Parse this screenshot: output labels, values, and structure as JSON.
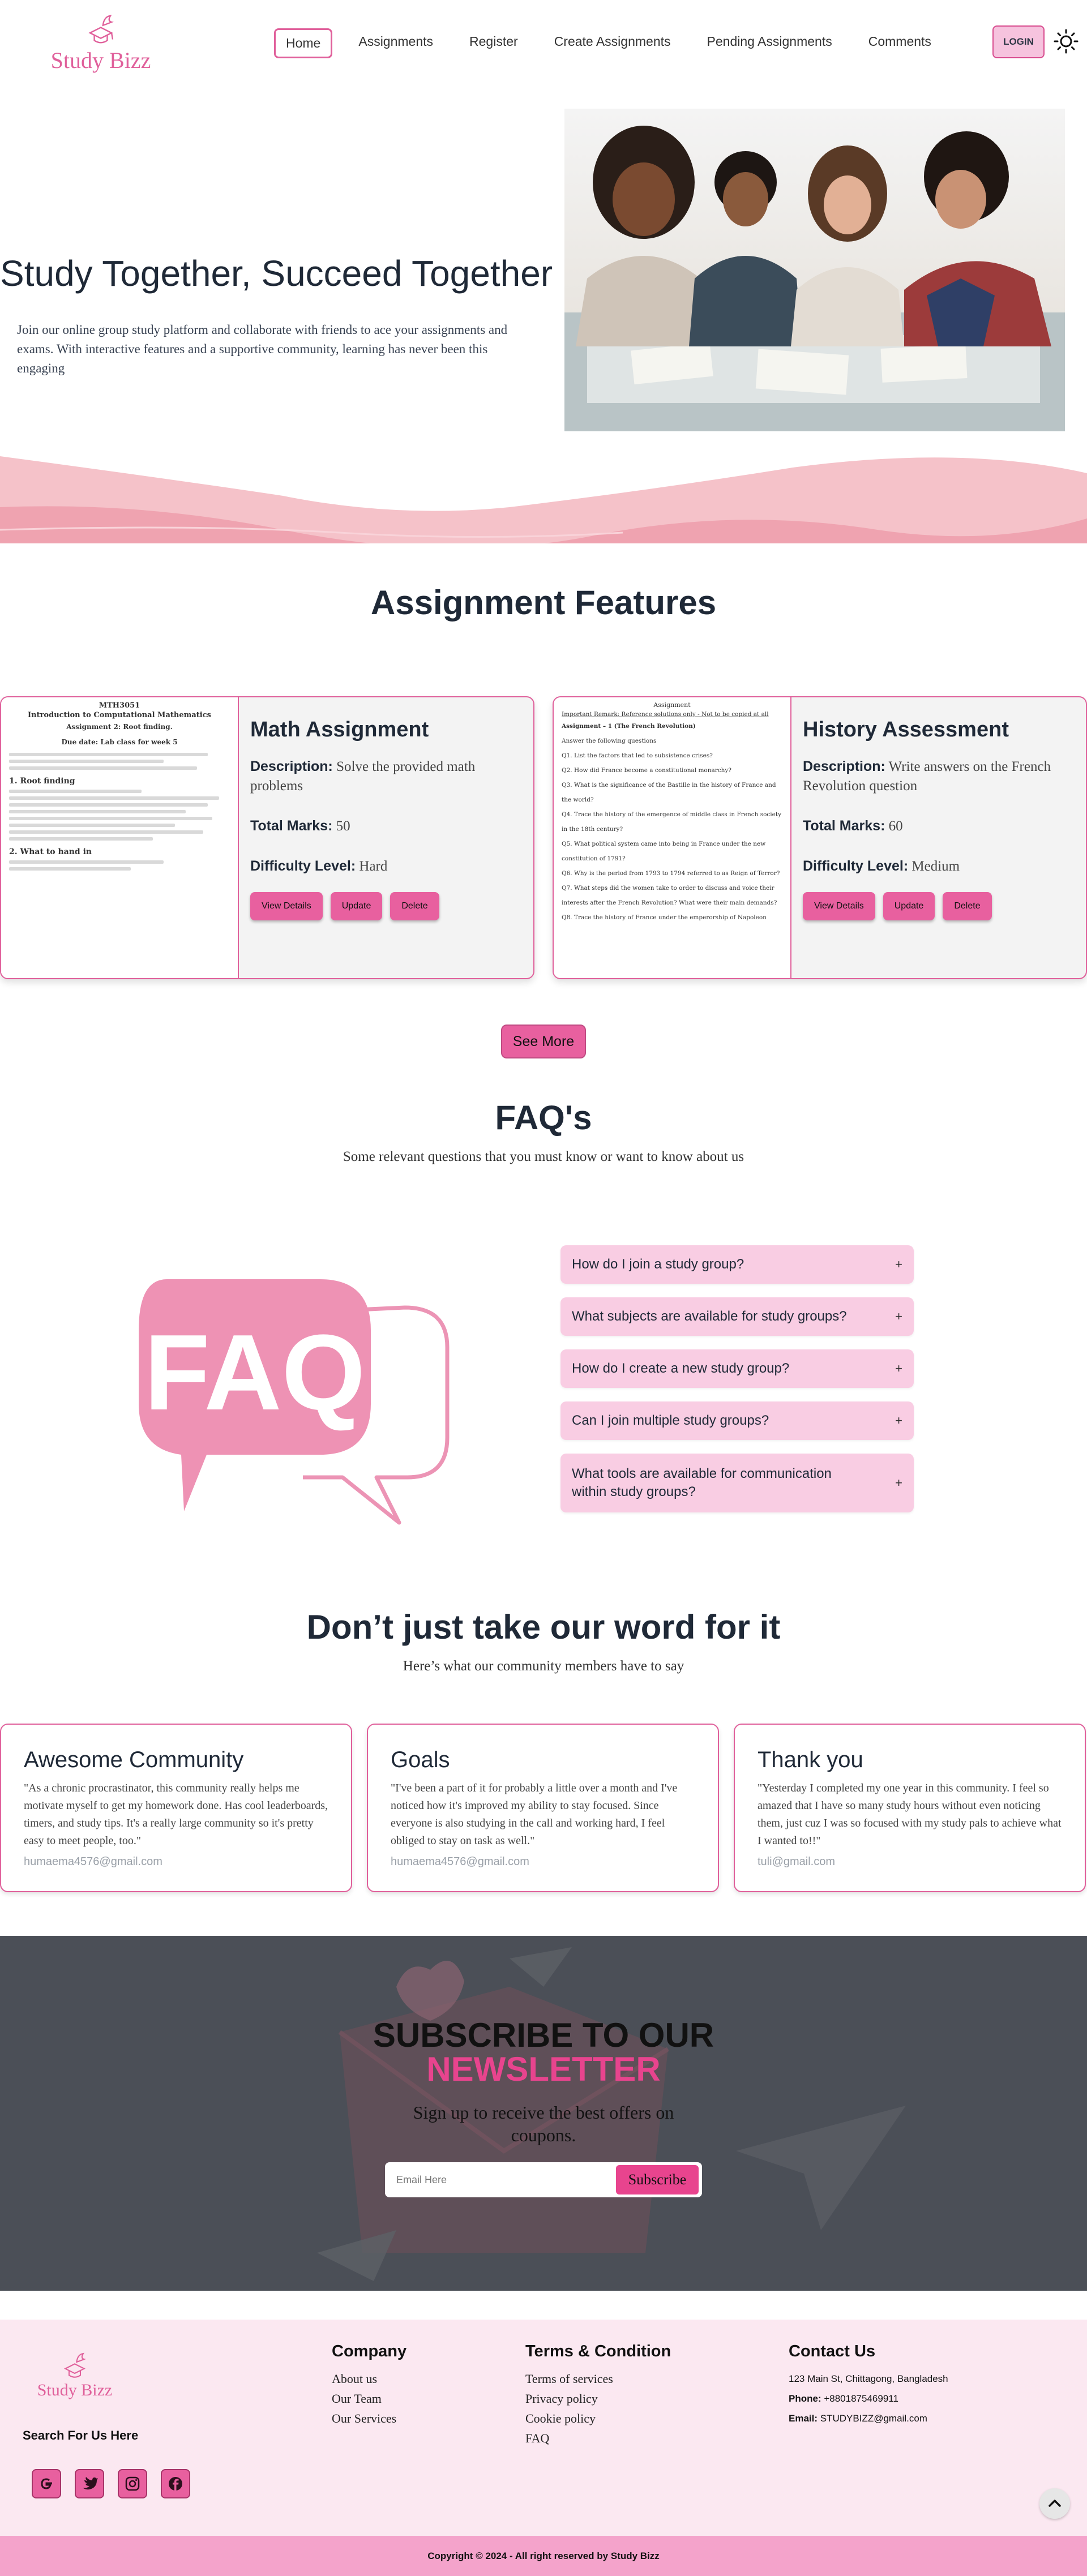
{
  "brand": {
    "name": "Study Bizz"
  },
  "nav": {
    "links": [
      "Home",
      "Assignments",
      "Register",
      "Create Assignments",
      "Pending Assignments",
      "Comments"
    ],
    "login": "LOGIN"
  },
  "hero": {
    "title": "Study Together, Succeed Together",
    "text": "Join our online group study platform and collaborate with friends to ace your assignments and exams. With interactive features and a supportive community, learning has never been this engaging"
  },
  "features": {
    "title": "Assignment Features",
    "cards": [
      {
        "title": "Math Assignment",
        "description_label": "Description:",
        "description": "Solve the provided math problems",
        "marks_label": "Total Marks:",
        "marks": "50",
        "difficulty_label": "Difficulty Level:",
        "difficulty": "Hard",
        "doc": {
          "code": "MTH3051",
          "title": "Introduction to Computational Mathematics",
          "subtitle": "Assignment 2: Root finding.",
          "due": "Due date: Lab class for week 5",
          "section1": "1. Root finding",
          "section2": "2. What to hand in"
        }
      },
      {
        "title": "History Assessment",
        "description_label": "Description:",
        "description": "Write answers on the French Revolution question",
        "marks_label": "Total Marks:",
        "marks": "60",
        "difficulty_label": "Difficulty Level:",
        "difficulty": "Medium",
        "doc": {
          "code": "Assignment",
          "title": "Important Remark: Reference solutions only - Not to be copied at all",
          "subtitle": "Assignment – 1 (The French Revolution)",
          "due": "Answer the following questions",
          "q1": "Q1. List the factors that led to subsistence crises?",
          "q2": "Q2. How did France become a constitutional monarchy?",
          "q3": "Q3. What is the significance of the Bastille in the history of France and the world?",
          "q4": "Q4. Trace the history of the emergence of middle class in French society in the 18th century?",
          "q5": "Q5. What political system came into being in France under the new constitution of 1791?",
          "q6": "Q6. Why is the period from 1793 to 1794 referred to as Reign of Terror?",
          "q7": "Q7. What steps did the women take to order to discuss and voice their interests after the French Revolution? What were their main demands?",
          "q8": "Q8. Trace the history of France under the emperorship of Napoleon"
        }
      }
    ],
    "buttons": {
      "details": "View Details",
      "update": "Update",
      "delete": "Delete"
    },
    "see_more": "See More"
  },
  "faq": {
    "title": "FAQ's",
    "subtitle": "Some relevant questions that you must know or want to know about us",
    "art_text": "FAQ",
    "items": [
      "How do I join a study group?",
      "What subjects are available for study groups?",
      "How do I create a new study group?",
      "Can I join multiple study groups?",
      "What tools are available for communication within study groups?"
    ]
  },
  "testimonials": {
    "title": "Don’t just take our word for it",
    "subtitle": "Here’s what our community members have to say",
    "items": [
      {
        "title": "Awesome Community",
        "text": "\"As a chronic procrastinator, this community really helps me motivate myself to get my homework done. Has cool leaderboards, timers, and study tips. It's a really large community so it's pretty easy to meet people, too.\"",
        "email": "humaema4576@gmail.com"
      },
      {
        "title": "Goals",
        "text": "\"I've been a part of it for probably a little over a month and I've noticed how it's improved my ability to stay focused. Since everyone is also studying in the call and working hard, I feel obliged to stay on task as well.\"",
        "email": "humaema4576@gmail.com"
      },
      {
        "title": "Thank you",
        "text": "\"Yesterday I completed my one year in this community. I feel so amazed that I have so many study hours without even noticing them, just cuz I was so focused with my study pals to achieve what I wanted to!!\"",
        "email": "tuli@gmail.com"
      }
    ]
  },
  "newsletter": {
    "line1": "SUBSCRIBE TO OUR",
    "line2": "NEWSLETTER",
    "text": "Sign up to receive the best offers on coupons.",
    "placeholder": "Email Here",
    "button": "Subscribe"
  },
  "footer": {
    "search_us": "Search For Us Here",
    "company": {
      "title": "Company",
      "links": [
        "About us",
        "Our Team",
        "Our Services"
      ]
    },
    "terms": {
      "title": "Terms & Condition",
      "links": [
        "Terms of services",
        "Privacy policy",
        "Cookie policy",
        "FAQ"
      ]
    },
    "contact": {
      "title": "Contact Us",
      "address": "123 Main St, Chittagong, Bangladesh",
      "phone_label": "Phone:",
      "phone": "+8801875469911",
      "email_label": "Email:",
      "email": "STUDYBIZZ@gmail.com"
    },
    "copyright": "Copyright © 2024 - All right reserved by Study Bizz"
  },
  "colors": {
    "accent": "#e8609f",
    "brand": "#e0609b",
    "pink_light": "#f9cde3",
    "dark": "#4b4f57"
  }
}
